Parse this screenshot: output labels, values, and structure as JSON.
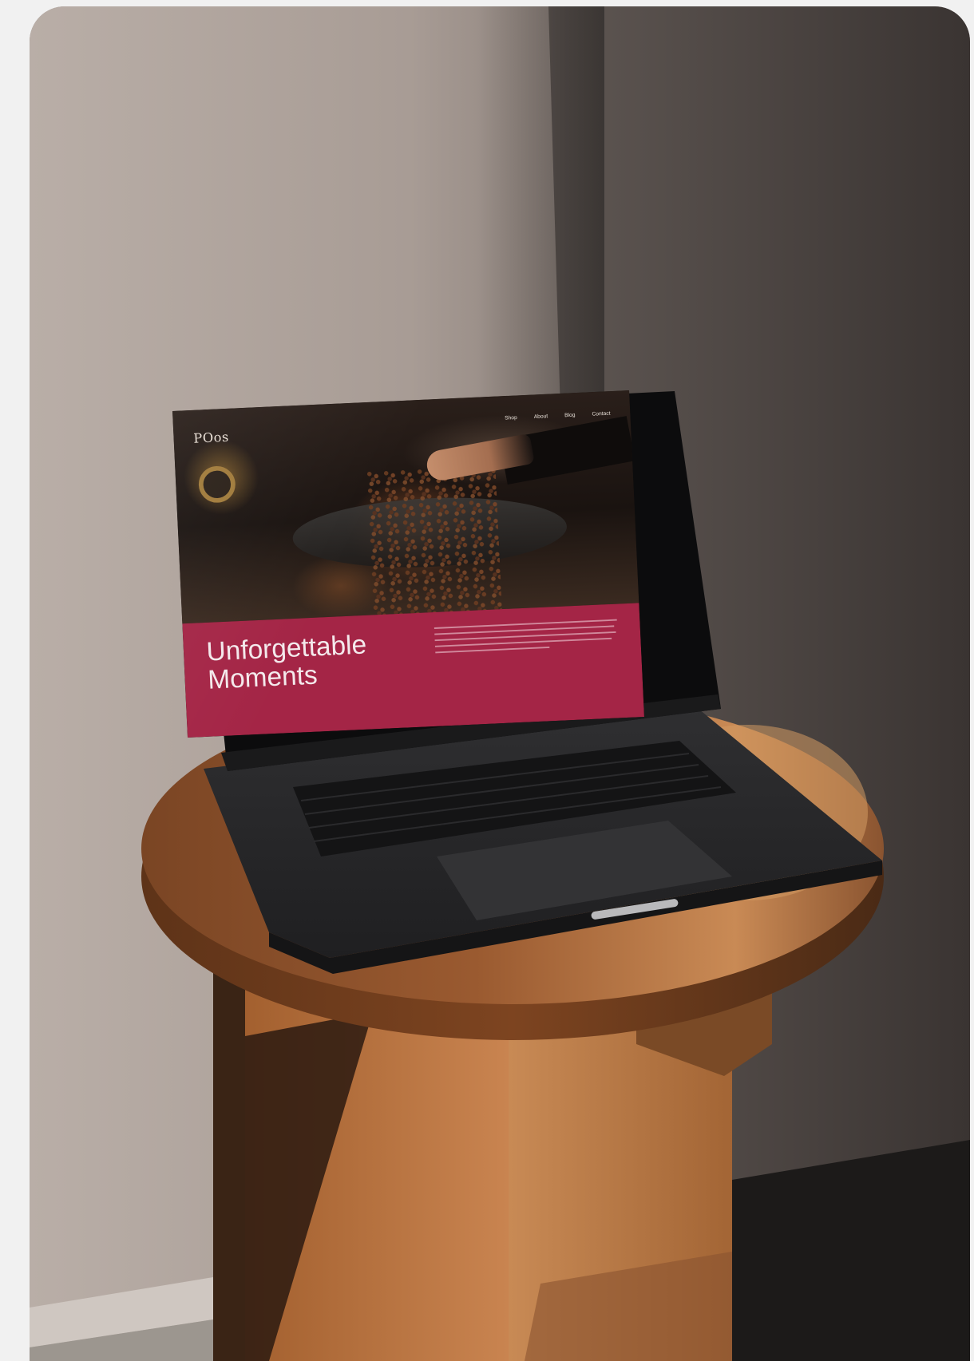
{
  "photo": {
    "scene": "laptop-on-wooden-side-table",
    "colors": {
      "page_background": "#f1f1f1",
      "wall_light": "#b8aca5",
      "wall_shadow": "#4a4340",
      "wood": "#b8713f",
      "laptop": "#2c2c2e",
      "banner": "#a42546"
    }
  },
  "website": {
    "logo": "POos",
    "nav": [
      "Shop",
      "About",
      "Blog",
      "Contact"
    ],
    "headline_line1": "Unforgettable",
    "headline_line2": "Moments"
  }
}
